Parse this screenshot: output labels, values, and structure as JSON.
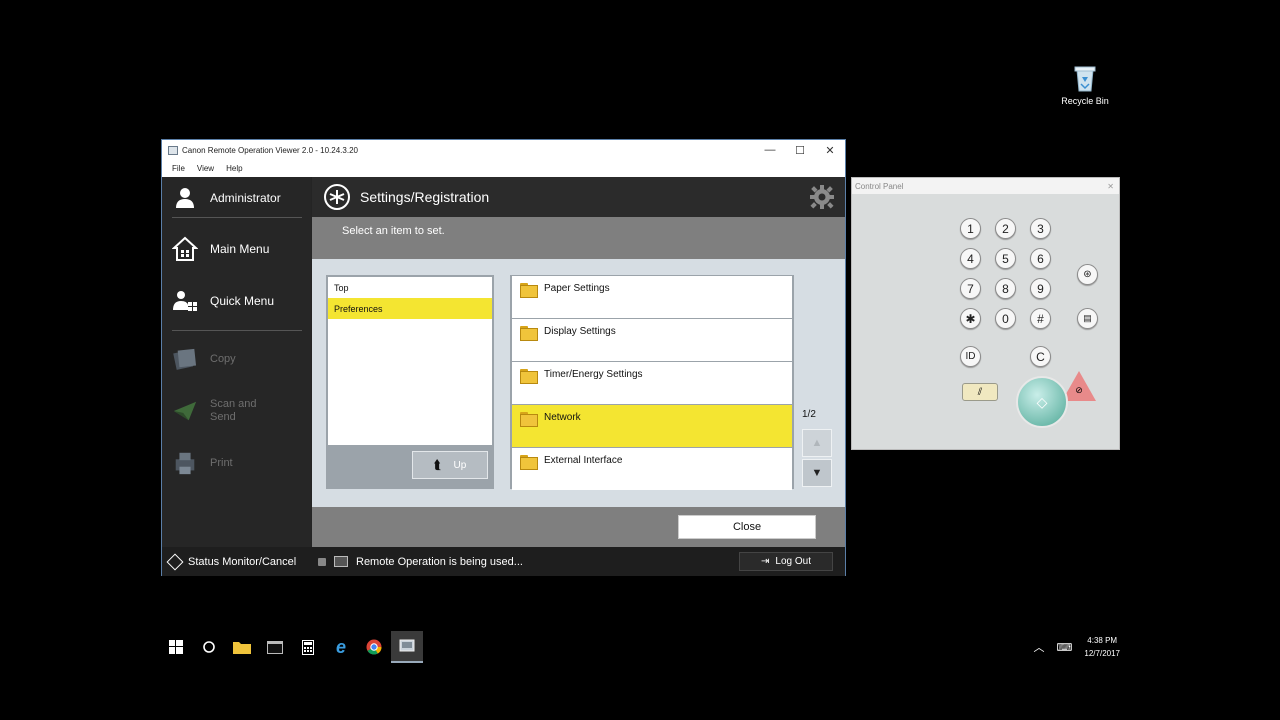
{
  "desktop": {
    "recycle_bin_label": "Recycle Bin"
  },
  "window": {
    "title": "Canon Remote Operation Viewer 2.0 - 10.24.3.20",
    "menu": [
      "File",
      "View",
      "Help"
    ],
    "controls": {
      "minimize": "—",
      "maximize": "☐",
      "close": "✕"
    }
  },
  "sidebar": {
    "user": "Administrator",
    "main_menu": "Main Menu",
    "quick_menu": "Quick Menu",
    "copy": "Copy",
    "scan_send_line1": "Scan and",
    "scan_send_line2": "Send",
    "print": "Print"
  },
  "header": {
    "title": "Settings/Registration",
    "instruction": "Select an item to set."
  },
  "tree": {
    "items": [
      "Top",
      "Preferences"
    ],
    "selected": "Preferences",
    "up_label": "Up"
  },
  "list": {
    "items": [
      "Paper Settings",
      "Display Settings",
      "Timer/Energy Settings",
      "Network",
      "External Interface"
    ],
    "selected": "Network",
    "page": "1/2"
  },
  "footer": {
    "close_label": "Close"
  },
  "status": {
    "monitor": "Status Monitor/Cancel",
    "message": "Remote Operation is being used...",
    "logout": "Log Out"
  },
  "control_panel": {
    "title": "Control Panel",
    "close": "✕",
    "keys": [
      "1",
      "2",
      "3",
      "4",
      "5",
      "6",
      "7",
      "8",
      "9",
      "✱",
      "0",
      "#"
    ],
    "id_key": "ID",
    "clear_key": "C"
  },
  "taskbar": {
    "time": "4:38 PM",
    "date": "12/7/2017"
  }
}
